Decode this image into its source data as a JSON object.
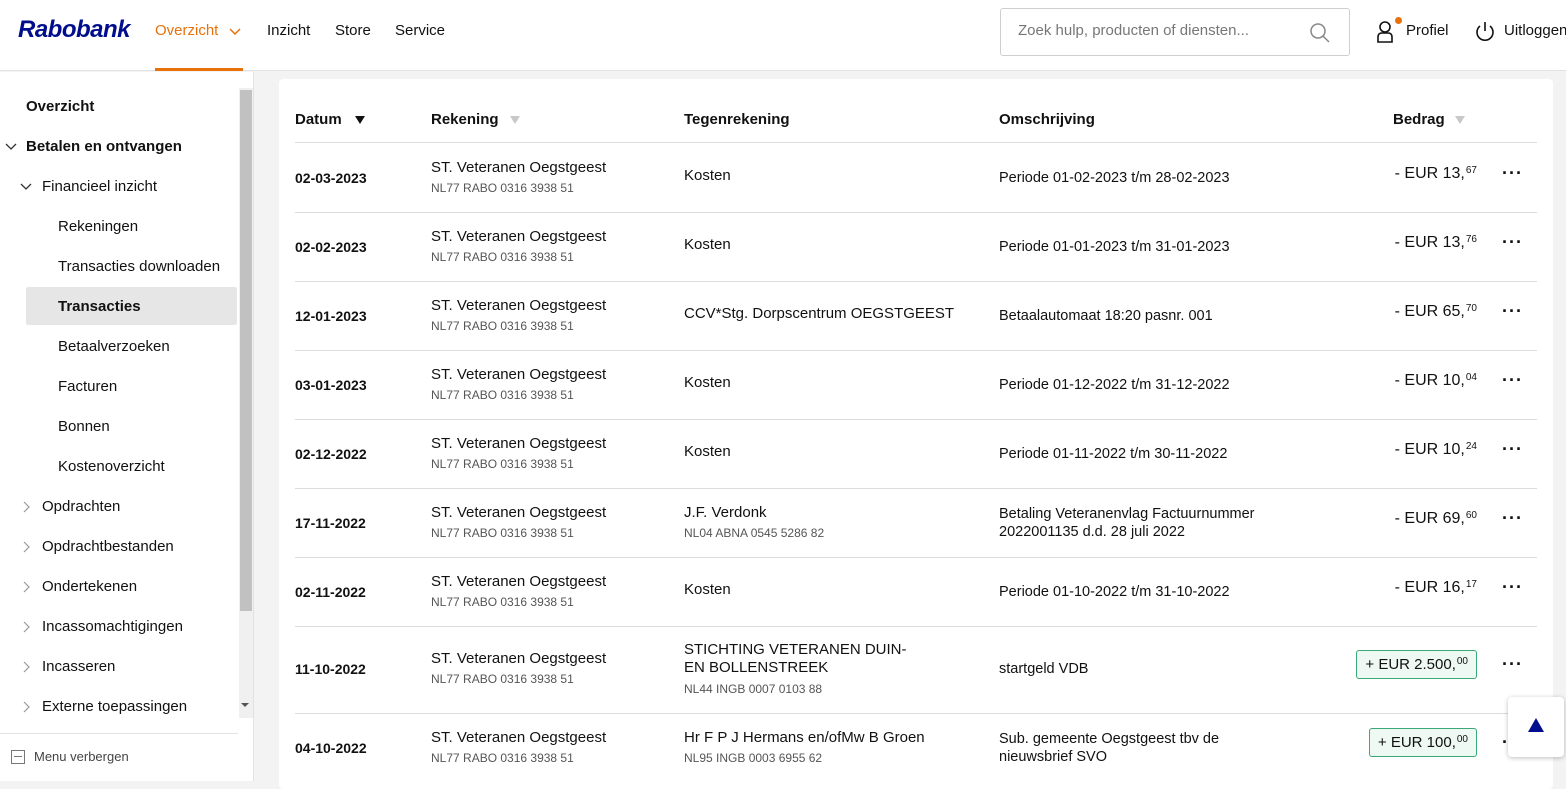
{
  "brand": "Rabobank",
  "nav": {
    "items": [
      "Overzicht",
      "Inzicht",
      "Store",
      "Service"
    ],
    "active": "Overzicht"
  },
  "search": {
    "placeholder": "Zoek hulp, producten of diensten..."
  },
  "header_actions": {
    "profile": "Profiel",
    "logout": "Uitloggen"
  },
  "sidebar": {
    "items": [
      {
        "label": "Overzicht"
      },
      {
        "label": "Betalen en ontvangen"
      },
      {
        "label": "Financieel inzicht"
      },
      {
        "label": "Rekeningen"
      },
      {
        "label": "Transacties downloaden"
      },
      {
        "label": "Transacties"
      },
      {
        "label": "Betaalverzoeken"
      },
      {
        "label": "Facturen"
      },
      {
        "label": "Bonnen"
      },
      {
        "label": "Kostenoverzicht"
      },
      {
        "label": "Opdrachten"
      },
      {
        "label": "Opdrachtbestanden"
      },
      {
        "label": "Ondertekenen"
      },
      {
        "label": "Incassomachtigingen"
      },
      {
        "label": "Incasseren"
      },
      {
        "label": "Externe toepassingen"
      }
    ],
    "active": "Transacties",
    "menu_hide": "Menu verbergen"
  },
  "table": {
    "columns": {
      "date": "Datum",
      "account": "Rekening",
      "counterparty": "Tegenrekening",
      "description": "Omschrijving",
      "amount": "Bedrag"
    },
    "rows": [
      {
        "date": "02-03-2023",
        "account": "ST. Veteranen Oegstgeest",
        "iban": "NL77 RABO 0316 3938 51",
        "counterparty": "Kosten",
        "counter_iban": "",
        "description": "Periode 01-02-2023 t/m 28-02-2023",
        "amount_main": "- EUR 13,",
        "amount_cents": "67",
        "positive": false
      },
      {
        "date": "02-02-2023",
        "account": "ST. Veteranen Oegstgeest",
        "iban": "NL77 RABO 0316 3938 51",
        "counterparty": "Kosten",
        "counter_iban": "",
        "description": "Periode 01-01-2023 t/m 31-01-2023",
        "amount_main": "- EUR 13,",
        "amount_cents": "76",
        "positive": false
      },
      {
        "date": "12-01-2023",
        "account": "ST. Veteranen Oegstgeest",
        "iban": "NL77 RABO 0316 3938 51",
        "counterparty": "CCV*Stg. Dorpscentrum OEGSTGEEST",
        "counter_iban": "",
        "description": "Betaalautomaat 18:20 pasnr. 001",
        "amount_main": "- EUR 65,",
        "amount_cents": "70",
        "positive": false
      },
      {
        "date": "03-01-2023",
        "account": "ST. Veteranen Oegstgeest",
        "iban": "NL77 RABO 0316 3938 51",
        "counterparty": "Kosten",
        "counter_iban": "",
        "description": "Periode 01-12-2022 t/m 31-12-2022",
        "amount_main": "- EUR 10,",
        "amount_cents": "04",
        "positive": false
      },
      {
        "date": "02-12-2022",
        "account": "ST. Veteranen Oegstgeest",
        "iban": "NL77 RABO 0316 3938 51",
        "counterparty": "Kosten",
        "counter_iban": "",
        "description": "Periode 01-11-2022 t/m 30-11-2022",
        "amount_main": "- EUR 10,",
        "amount_cents": "24",
        "positive": false
      },
      {
        "date": "17-11-2022",
        "account": "ST. Veteranen Oegstgeest",
        "iban": "NL77 RABO 0316 3938 51",
        "counterparty": "J.F. Verdonk",
        "counter_iban": "NL04 ABNA 0545 5286 82",
        "description": "Betaling Veteranenvlag Factuurnummer 2022001135 d.d. 28 juli 2022",
        "amount_main": "- EUR 69,",
        "amount_cents": "60",
        "positive": false
      },
      {
        "date": "02-11-2022",
        "account": "ST. Veteranen Oegstgeest",
        "iban": "NL77 RABO 0316 3938 51",
        "counterparty": "Kosten",
        "counter_iban": "",
        "description": "Periode 01-10-2022 t/m 31-10-2022",
        "amount_main": "- EUR 16,",
        "amount_cents": "17",
        "positive": false
      },
      {
        "date": "11-10-2022",
        "account": "ST. Veteranen Oegstgeest",
        "iban": "NL77 RABO 0316 3938 51",
        "counterparty": "STICHTING VETERANEN DUIN- EN BOLLENSTREEK",
        "counter_iban": "NL44 INGB 0007 0103 88",
        "description": "startgeld VDB",
        "amount_main": "+ EUR 2.500,",
        "amount_cents": "00",
        "positive": true
      },
      {
        "date": "04-10-2022",
        "account": "ST. Veteranen Oegstgeest",
        "iban": "NL77 RABO 0316 3938 51",
        "counterparty": "Hr F P J Hermans en/ofMw B Groen",
        "counter_iban": "NL95 INGB 0003 6955 62",
        "description": "Sub. gemeente Oegstgeest tbv de nieuwsbrief SVO",
        "amount_main": "+ EUR 100,",
        "amount_cents": "00",
        "positive": true
      }
    ]
  },
  "colors": {
    "brand_blue": "#000d8c",
    "accent_orange": "#e8710a",
    "positive_green": "#3aa877"
  }
}
